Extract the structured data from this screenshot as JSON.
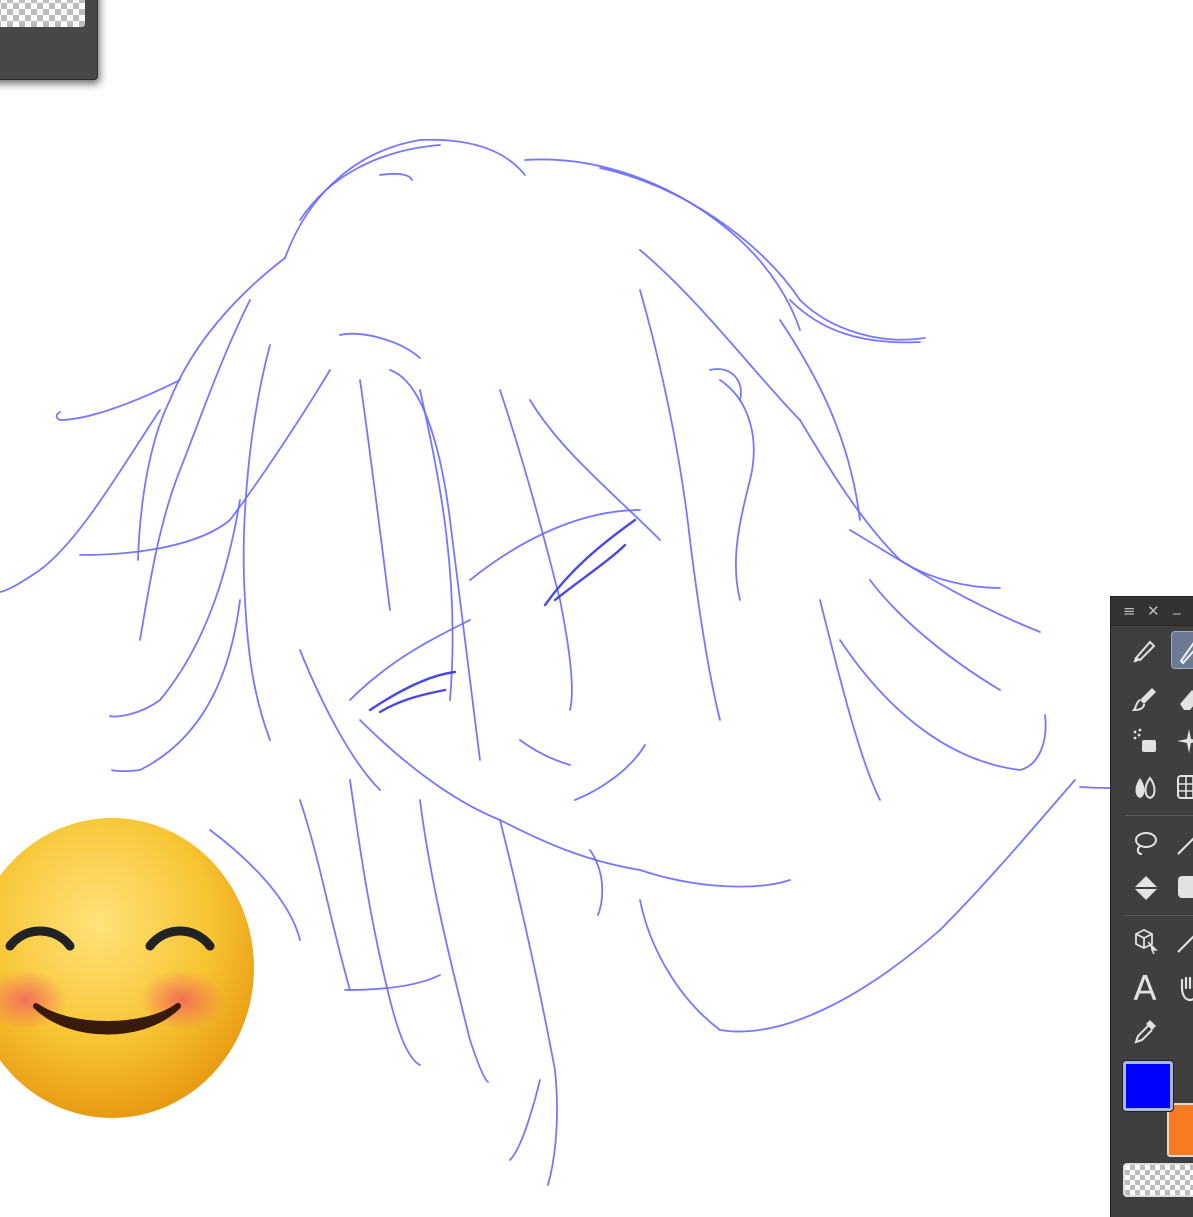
{
  "app": {
    "canvas": {
      "background": "#ffffff",
      "sketch_color": "#6b6bff"
    },
    "top_panel": {
      "preview": "transparent-checkerboard"
    },
    "tool_palette": {
      "header_icons": {
        "menu": "≡",
        "close": "✕",
        "minimize": "_"
      },
      "tools": [
        {
          "name": "pencil",
          "icon": "pencil-icon"
        },
        {
          "name": "pen",
          "icon": "pen-icon",
          "active": true
        },
        {
          "name": "brush",
          "icon": "brush-icon"
        },
        {
          "name": "eraser",
          "icon": "eraser-icon"
        },
        {
          "name": "airbrush",
          "icon": "airbrush-icon"
        },
        {
          "name": "sparkle",
          "icon": "sparkle-icon"
        },
        {
          "name": "blend",
          "icon": "blend-icon"
        },
        {
          "name": "grid",
          "icon": "grid-icon"
        },
        {
          "name": "lasso",
          "icon": "lasso-icon"
        },
        {
          "name": "magic-wand",
          "icon": "magic-wand-icon"
        },
        {
          "name": "fill",
          "icon": "fill-bucket-icon"
        },
        {
          "name": "gradient",
          "icon": "gradient-icon"
        },
        {
          "name": "object",
          "icon": "object-select-icon"
        },
        {
          "name": "line",
          "icon": "line-icon"
        },
        {
          "name": "text",
          "icon": "text-icon",
          "glyph": "A"
        },
        {
          "name": "hand",
          "icon": "hand-icon"
        },
        {
          "name": "eyedropper",
          "icon": "eyedropper-icon"
        }
      ],
      "colors": {
        "main": "#0000ff",
        "sub": "#f77a22",
        "transparent": "checkerboard"
      }
    },
    "sticker": {
      "icon": "smiling-face-emoji-icon",
      "face": "#f7c534",
      "blush": "#f26a5a"
    }
  }
}
